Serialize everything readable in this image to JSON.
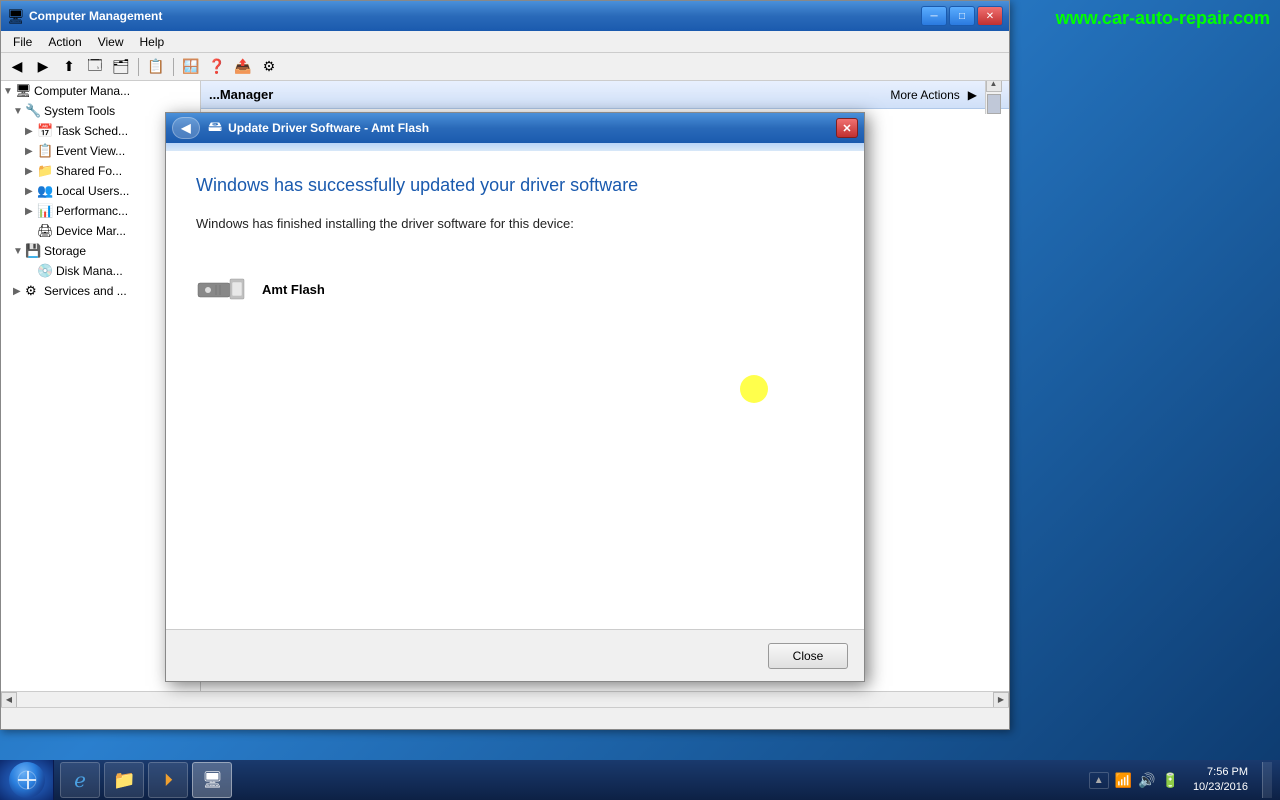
{
  "watermark": "www.car-auto-repair.com",
  "desktop": {
    "background": "#1a5c9e"
  },
  "cm_window": {
    "title": "Computer Management",
    "menu": [
      "File",
      "Action",
      "View",
      "Help"
    ],
    "tree": [
      {
        "label": "Computer Management (Local)",
        "level": 0,
        "expanded": true,
        "icon": "🖥"
      },
      {
        "label": "System Tools",
        "level": 1,
        "expanded": true,
        "icon": "🔧"
      },
      {
        "label": "Task Scheduler",
        "level": 2,
        "expanded": false,
        "icon": "📅"
      },
      {
        "label": "Event Viewer",
        "level": 2,
        "expanded": false,
        "icon": "📋"
      },
      {
        "label": "Shared Folders",
        "level": 2,
        "expanded": false,
        "icon": "📁"
      },
      {
        "label": "Local Users and Groups",
        "level": 2,
        "expanded": false,
        "icon": "👥"
      },
      {
        "label": "Performance",
        "level": 2,
        "expanded": false,
        "icon": "📊"
      },
      {
        "label": "Device Manager",
        "level": 2,
        "expanded": false,
        "icon": "🖨"
      },
      {
        "label": "Storage",
        "level": 1,
        "expanded": true,
        "icon": "💾"
      },
      {
        "label": "Disk Management",
        "level": 2,
        "expanded": false,
        "icon": "💿"
      },
      {
        "label": "Services and Applications",
        "level": 1,
        "expanded": false,
        "icon": "⚙"
      }
    ],
    "right_header": {
      "title": "Device Manager",
      "more_actions": "More Actions"
    }
  },
  "dialog": {
    "title": "Update Driver Software - Amt Flash",
    "close_label": "✕",
    "back_label": "◀",
    "success_title": "Windows has successfully updated your driver software",
    "success_desc": "Windows has finished installing the driver software for this device:",
    "device_name": "Amt Flash",
    "close_button": "Close"
  },
  "taskbar": {
    "time": "7:56 PM",
    "date": "10/23/2016",
    "items": [
      {
        "label": "Start",
        "icon": "⊞"
      },
      {
        "label": "Internet Explorer",
        "icon": "ℯ"
      },
      {
        "label": "Windows Explorer",
        "icon": "📁"
      },
      {
        "label": "Windows Media Player",
        "icon": "▶"
      },
      {
        "label": "Computer Management",
        "icon": "🖥",
        "active": true
      }
    ]
  }
}
